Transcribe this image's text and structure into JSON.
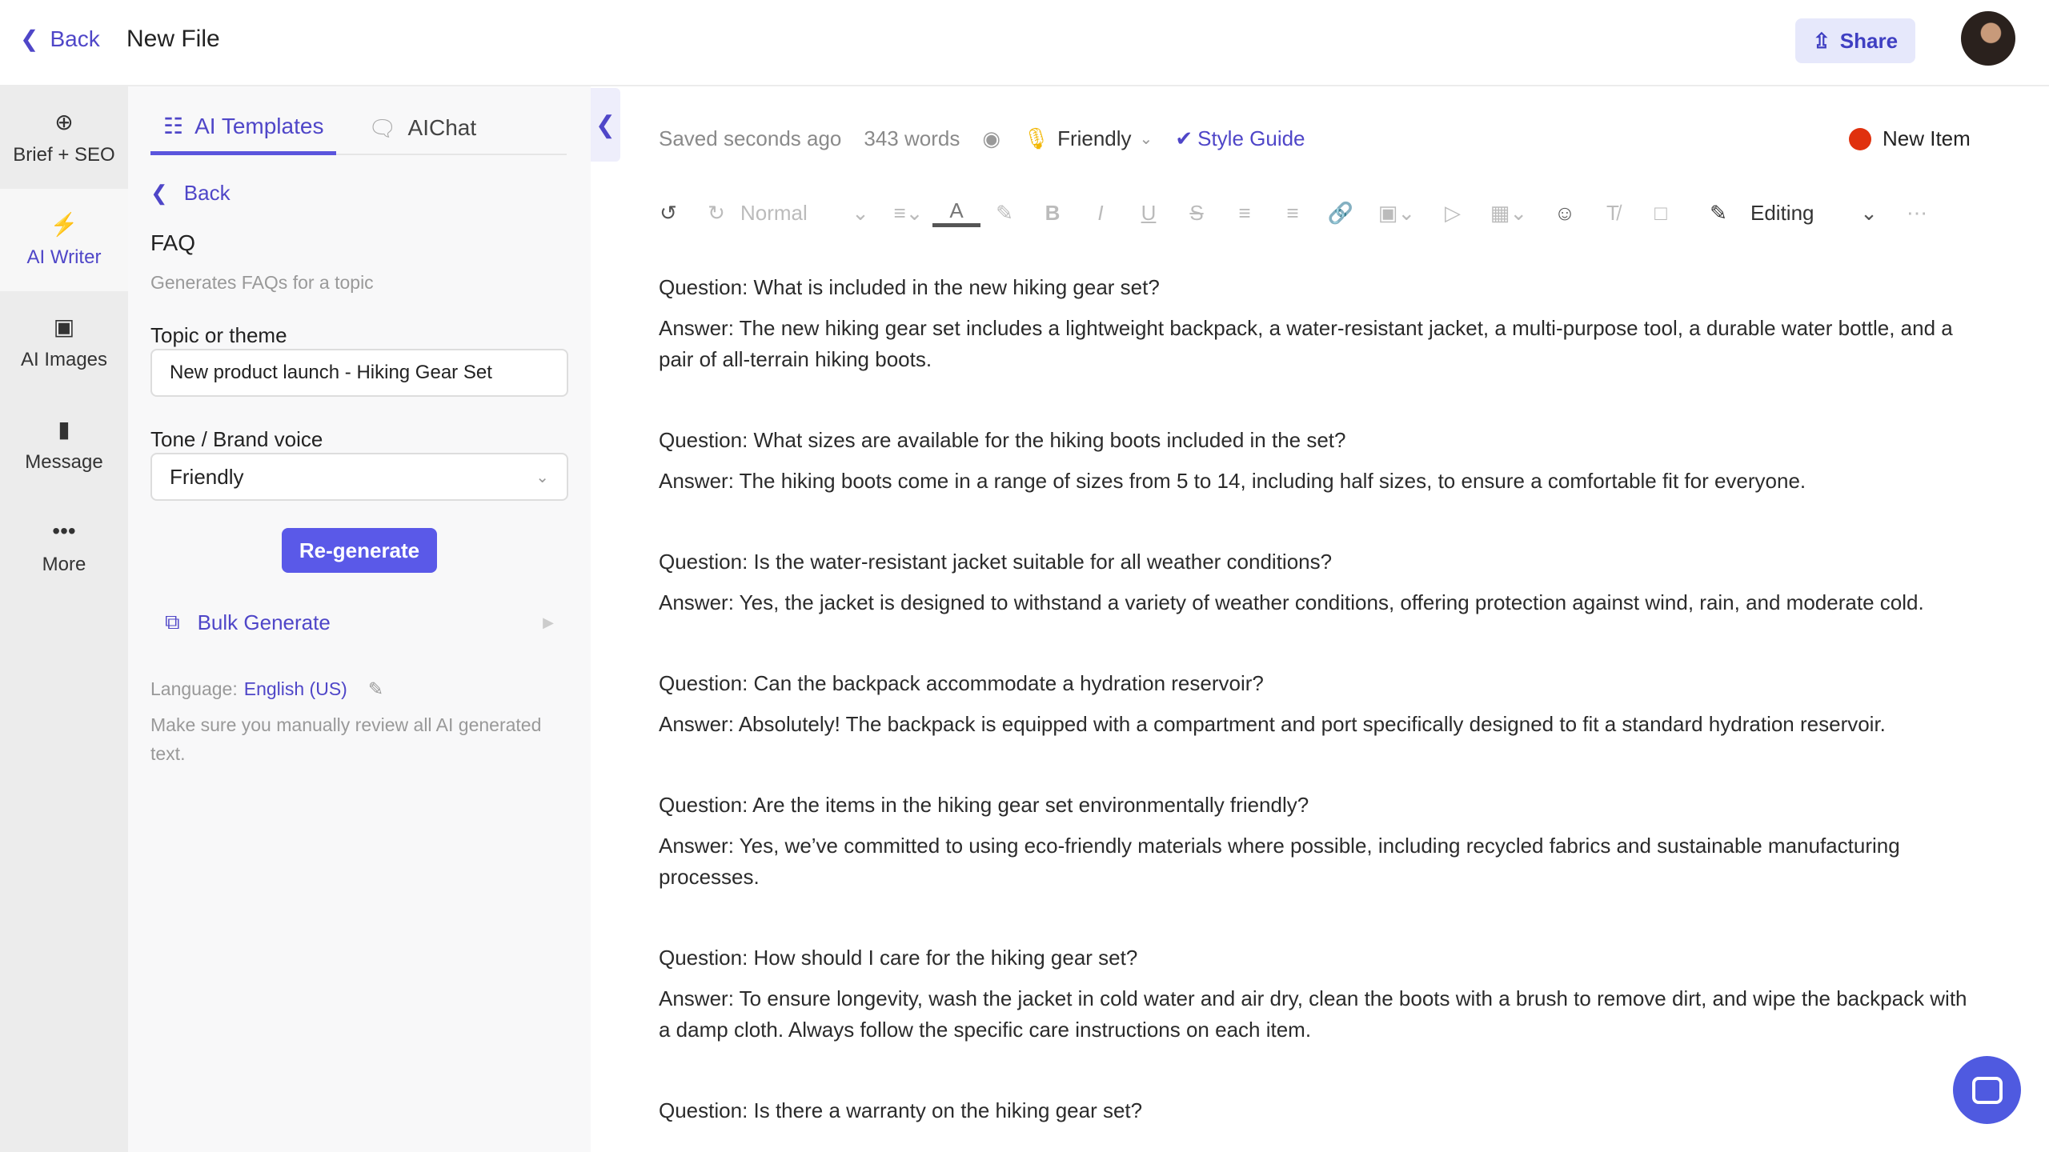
{
  "header": {
    "back": "Back",
    "title": "New File",
    "share": "Share"
  },
  "rail": [
    {
      "label": "Brief + SEO",
      "icon": "crosshair-icon"
    },
    {
      "label": "AI Writer",
      "icon": "lightning-icon"
    },
    {
      "label": "AI Images",
      "icon": "image-icon"
    },
    {
      "label": "Message",
      "icon": "message-icon"
    },
    {
      "label": "More",
      "icon": "more-icon"
    }
  ],
  "panel": {
    "tabs": [
      {
        "label": "AI Templates"
      },
      {
        "label": "AIChat"
      }
    ],
    "back": "Back",
    "template_title": "FAQ",
    "template_desc": "Generates FAQs for a topic",
    "topic_label": "Topic or theme",
    "topic_value": "New product launch - Hiking Gear Set",
    "tone_label": "Tone / Brand voice",
    "tone_value": "Friendly",
    "regenerate": "Re-generate",
    "bulk": "Bulk Generate",
    "language_label": "Language:",
    "language_value": "English (US)",
    "disclaimer": "Make sure you manually review all AI generated text."
  },
  "editor": {
    "saved": "Saved seconds ago",
    "words": "343 words",
    "tone": "Friendly",
    "style_guide": "Style Guide",
    "new_item": "New Item",
    "toolbar": {
      "style": "Normal",
      "mode": "Editing"
    },
    "faqs": [
      {
        "q": "Question: What is included in the new hiking gear set?",
        "a": "Answer: The new hiking gear set includes a lightweight backpack, a water-resistant jacket, a multi-purpose tool, a durable water bottle, and a pair of all-terrain hiking boots."
      },
      {
        "q": "Question: What sizes are available for the hiking boots included in the set?",
        "a": "Answer: The hiking boots come in a range of sizes from 5 to 14, including half sizes, to ensure a comfortable fit for everyone."
      },
      {
        "q": "Question: Is the water-resistant jacket suitable for all weather conditions?",
        "a": "Answer: Yes, the jacket is designed to withstand a variety of weather conditions, offering protection against wind, rain, and moderate cold."
      },
      {
        "q": "Question: Can the backpack accommodate a hydration reservoir?",
        "a": "Answer: Absolutely! The backpack is equipped with a compartment and port specifically designed to fit a standard hydration reservoir."
      },
      {
        "q": "Question: Are the items in the hiking gear set environmentally friendly?",
        "a": "Answer: Yes, we’ve committed to using eco-friendly materials where possible, including recycled fabrics and sustainable manufacturing processes."
      },
      {
        "q": "Question: How should I care for the hiking gear set?",
        "a": "Answer: To ensure longevity, wash the jacket in cold water and air dry, clean the boots with a brush to remove dirt, and wipe the backpack with a damp cloth. Always follow the specific care instructions on each item."
      },
      {
        "q": "Question: Is there a warranty on the hiking gear set?",
        "a": ""
      }
    ]
  },
  "colors": {
    "accent": "#5a59e8",
    "new_item_dot": "#e0310e"
  }
}
